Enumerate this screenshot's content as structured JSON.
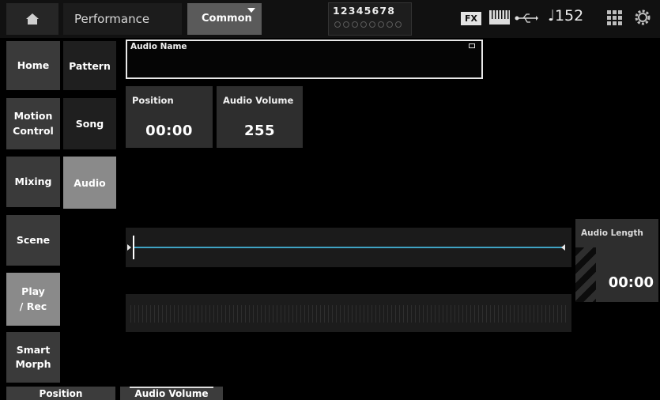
{
  "topbar": {
    "title": "Performance",
    "common_tab": "Common",
    "parts_numbers": "12345678",
    "fx_badge": "FX",
    "tempo": "♩152",
    "icons": [
      "home-icon",
      "keyboard-icon",
      "usb-icon",
      "grid-icon",
      "gear-icon"
    ]
  },
  "nav_primary": [
    {
      "label": "Home",
      "active": false
    },
    {
      "label": "Motion\nControl",
      "active": false
    },
    {
      "label": "Mixing",
      "active": false
    },
    {
      "label": "Scene",
      "active": false
    },
    {
      "label": "Play\n/ Rec",
      "active": true
    },
    {
      "label": "Smart\nMorph",
      "active": false
    }
  ],
  "nav_secondary": [
    {
      "label": "Pattern",
      "active": false
    },
    {
      "label": "Song",
      "active": false
    },
    {
      "label": "Audio",
      "active": true
    }
  ],
  "audio_name": {
    "label": "Audio Name",
    "value": ""
  },
  "params": {
    "position": {
      "label": "Position",
      "value": "00:00"
    },
    "audio_volume": {
      "label": "Audio Volume",
      "value": "255"
    }
  },
  "audio_length": {
    "label": "Audio Length",
    "value": "00:00"
  },
  "bottom_tabs": {
    "position": "Position",
    "audio_volume": "Audio Volume"
  },
  "colors": {
    "timeline_line": "#3fa3c4",
    "active_nav": "#8a8a8a",
    "panel": "#2e2e2e"
  }
}
